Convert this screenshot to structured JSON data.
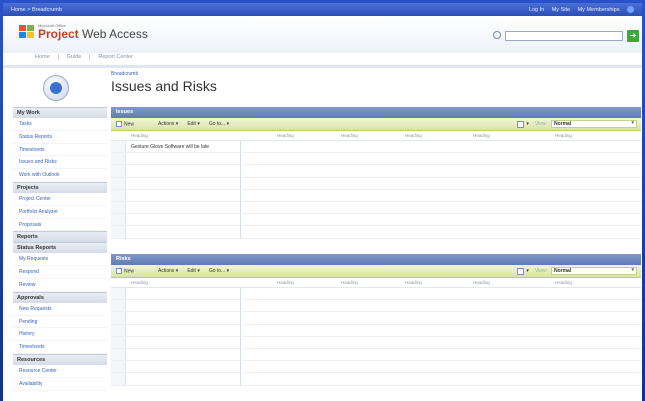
{
  "topbar": {
    "breadcrumb": "Home > Breadcrumb",
    "links": [
      "Log In",
      "My Site",
      "My Memberships"
    ]
  },
  "brand": {
    "microsoft": "Microsoft Office",
    "product_bold": "Project",
    "product_rest": " Web Access"
  },
  "search": {
    "placeholder": ""
  },
  "nav": {
    "tabs": [
      "Home",
      "Guide",
      "Report Center"
    ]
  },
  "main": {
    "breadcrumb": "Breadcrumb",
    "title": "Issues and Risks"
  },
  "sidebar": {
    "sections": [
      {
        "heading": "My Work",
        "items": [
          "Tasks",
          "Status Reports",
          "Timesheets",
          "Issues and Risks",
          "Work with Outlook"
        ]
      },
      {
        "heading": "Projects",
        "items": [
          "Project Center",
          "Portfolio Analyzer",
          "Proposals"
        ]
      },
      {
        "heading": "Reports",
        "items": []
      },
      {
        "heading": "Status Reports",
        "items": [
          "My Requests",
          "Respond",
          "Review"
        ]
      },
      {
        "heading": "Approvals",
        "items": [
          "New Requests",
          "Pending",
          "History",
          "Timesheets"
        ]
      },
      {
        "heading": "Resources",
        "items": [
          "Resource Center",
          "Availability"
        ]
      }
    ]
  },
  "toolbar": {
    "new": "New",
    "actions": "Actions ▾",
    "edit": "Edit ▾",
    "goto": "Go to... ▾",
    "view_label": "View:",
    "view_value": "Normal"
  },
  "columns": [
    "Heading",
    "Heading",
    "Heading",
    "Heading",
    "Heading",
    "Heading"
  ],
  "issues": {
    "title": "Issues",
    "rows": [
      "Gesture Glove Software will be late",
      "",
      "",
      "",
      "",
      "",
      "",
      ""
    ]
  },
  "risks": {
    "title": "Risks",
    "rows": [
      "",
      "",
      "",
      "",
      "",
      "",
      "",
      ""
    ]
  }
}
